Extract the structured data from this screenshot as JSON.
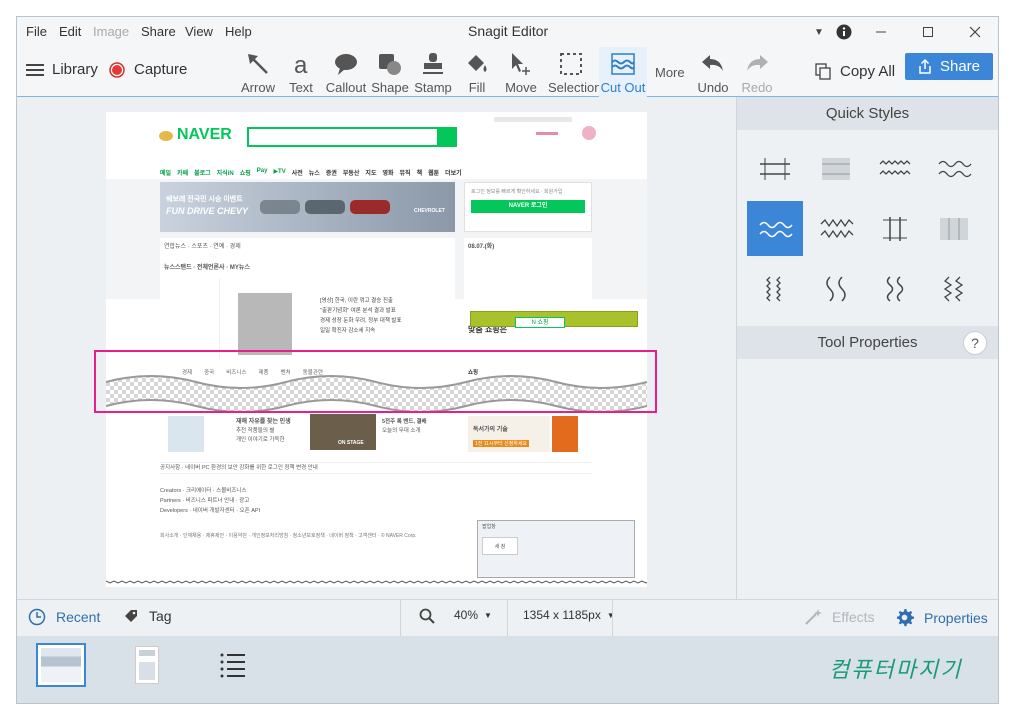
{
  "menu": {
    "file": "File",
    "edit": "Edit",
    "image": "Image",
    "share": "Share",
    "view": "View",
    "help": "Help"
  },
  "window": {
    "title": "Snagit Editor"
  },
  "toolbar": {
    "library": "Library",
    "capture": "Capture",
    "tools": [
      "Arrow",
      "Text",
      "Callout",
      "Shape",
      "Stamp",
      "Fill",
      "Move",
      "Selection",
      "Cut Out"
    ],
    "more": "More",
    "undo": "Undo",
    "redo": "Redo",
    "copy_all": "Copy All",
    "share": "Share"
  },
  "right_panel": {
    "quick_styles": "Quick Styles",
    "tool_properties": "Tool Properties",
    "help": "?"
  },
  "bottom": {
    "recent": "Recent",
    "tag": "Tag",
    "zoom": "40%",
    "size": "1354 x 1185px",
    "effects": "Effects",
    "properties": "Properties"
  },
  "watermark": "컴퓨터마지기",
  "naver": {
    "logo": "NAVER",
    "nav": [
      "메일",
      "카페",
      "블로그",
      "지식iN",
      "쇼핑",
      "Pay",
      "▶TV",
      "사전",
      "뉴스",
      "증권",
      "부동산",
      "지도",
      "영화",
      "뮤직",
      "책",
      "웹툰",
      "더보기"
    ],
    "banner_line1": "쉐보레 전국민 시승 이벤트",
    "banner_line2": "FUN DRIVE CHEVY",
    "banner_brand": "CHEVROLET",
    "login_btn": "NAVER 로그인",
    "login_note": "로그인 정보를 빠르게 확인하세요 · 회원가입",
    "news_head": "연합뉴스 · 스포츠 · 연예 · 경제",
    "newsstand": "뉴스스탠드 · 전체언론사 · MY뉴스",
    "news_lines": [
      "[영상] 한국, 이란 꺾고 결승 진출",
      "\"출판기념회\" 여론 분석 결과 발표",
      "경제 성장 둔화 우려, 정부 대책 발표",
      "일일 확진자 감소세 지속"
    ],
    "date": "08.07.(화)",
    "shopping": "맞춤 쇼핑은",
    "popup_brand": "N 쇼핑",
    "cut_words": [
      "경제",
      "중국",
      "비즈니스",
      "제품",
      "벤처",
      "동물관련",
      "쇼핑"
    ],
    "lower_left": [
      "재해 자유를 찾는 인생",
      "추천 작품들의 별",
      "개인 이야기로 가득한"
    ],
    "on_stage": "ON STAGE",
    "lower_mid": [
      "5전주 록 밴드, 결배",
      "오늘의 무대 소개"
    ],
    "lower_right": [
      "독서가의 기술",
      "1전 11시부터 신청하세요"
    ],
    "notice": "공지사항 · 네이버 PC 환경의 보안 강화를 위한 로그인 정책 변경 안내",
    "footer_rows": [
      "Creators · 크리에이터 · 스몰비즈니스",
      "Partners · 비즈니스 파트너 안내 · 광고",
      "Developers · 네이버 개발자센터 · 오픈 API"
    ],
    "footer_links": "회사소개 · 인재채용 · 제휴제안 · 이용약관 · 개인정보처리방침 · 청소년보호정책 · 네이버 정책 · 고객센터 · © NAVER Corp.",
    "dialog_title": "팝업창",
    "dialog_btn": "새 창"
  }
}
